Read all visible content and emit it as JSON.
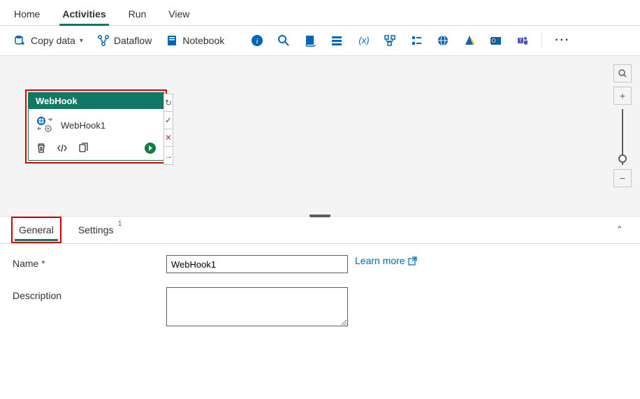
{
  "top_tabs": {
    "home": "Home",
    "activities": "Activities",
    "run": "Run",
    "view": "View",
    "active": "activities"
  },
  "toolbar": {
    "copy_data": "Copy data",
    "dataflow": "Dataflow",
    "notebook": "Notebook"
  },
  "activity": {
    "type": "WebHook",
    "name": "WebHook1"
  },
  "panel": {
    "tabs": {
      "general": "General",
      "settings": "Settings",
      "settings_badge": "1",
      "active": "general"
    }
  },
  "form": {
    "name_label": "Name",
    "name_value": "WebHook1",
    "learn_more": "Learn more",
    "description_label": "Description",
    "description_value": ""
  },
  "colors": {
    "accent": "#117865",
    "highlight": "#d40000",
    "link": "#0065b3"
  }
}
